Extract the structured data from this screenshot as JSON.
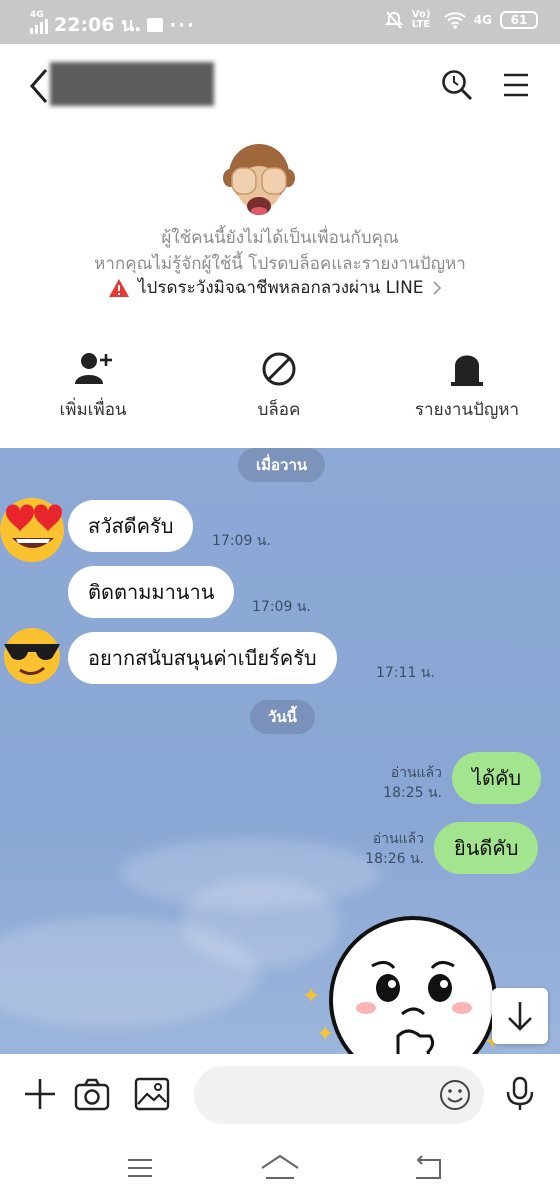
{
  "status_bar": {
    "network": "4G",
    "time": "22:06 น.",
    "more": "···",
    "volte": "Vo) LTE",
    "network_right": "4G",
    "battery": "61"
  },
  "header": {
    "contact_name": "",
    "icons": [
      "back-icon",
      "search-icon",
      "menu-icon"
    ]
  },
  "notice": {
    "line1": "ผู้ใช้คนนี้ยังไม่ได้เป็นเพื่อนกับคุณ",
    "line2": "หากคุณไม่รู้จักผู้ใช้นี้ โปรดบล็อคและรายงานปัญหา",
    "warning": "ไปรดระวังมิจฉาชีพหลอกลวงผ่าน LINE",
    "actions": [
      {
        "label": "เพิ่มเพื่อน",
        "icon": "add-friend-icon"
      },
      {
        "label": "บล็อค",
        "icon": "block-icon"
      },
      {
        "label": "รายงานปัญหา",
        "icon": "report-icon"
      }
    ]
  },
  "chat": {
    "date_yesterday": "เมื่อวาน",
    "date_today": "วันนี้",
    "messages": [
      {
        "direction": "in",
        "text": "สวัสดีครับ",
        "time": "17:09 น."
      },
      {
        "direction": "in",
        "text": "ติดตามมานาน",
        "time": "17:09 น."
      },
      {
        "direction": "in",
        "text": "อยากสนับสนุนค่าเบียร์ครับ",
        "time": "17:11 น."
      },
      {
        "direction": "out",
        "text": "ได้คับ",
        "time": "18:25 น.",
        "read": "อ่านแล้ว"
      },
      {
        "direction": "out",
        "text": "ยินดีคับ",
        "time": "18:26 น.",
        "read": "อ่านแล้ว"
      }
    ]
  },
  "input_bar": {
    "message_value": "",
    "icons": [
      "plus-icon",
      "camera-icon",
      "image-icon",
      "emoji-icon",
      "mic-icon"
    ]
  },
  "colors": {
    "chat_bg": "#8ea9d6",
    "bubble_out": "#a3e48f",
    "bubble_in": "#ffffff",
    "warning_red": "#e53935"
  }
}
